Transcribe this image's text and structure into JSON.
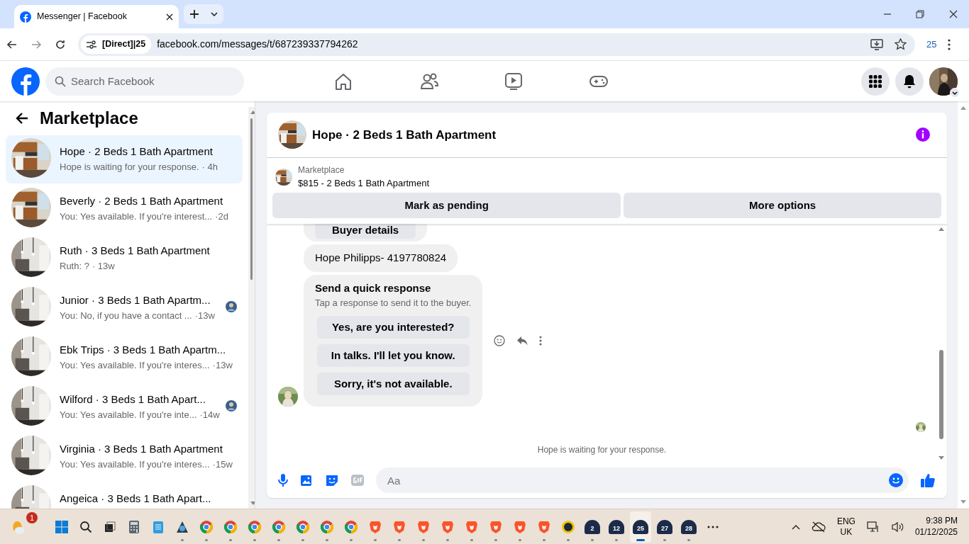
{
  "browser": {
    "tab_title": "Messenger | Facebook",
    "url_chip": "[Direct]|25",
    "url": "facebook.com/messages/t/687239337794262",
    "profile_count": "25"
  },
  "facebook": {
    "search": {
      "placeholder": "Search Facebook"
    }
  },
  "sidebar": {
    "title": "Marketplace",
    "conversations": [
      {
        "title": "Hope · 2 Beds 1 Bath Apartment",
        "preview": "Hope is waiting for your response.",
        "time": "· 4h",
        "selected": true,
        "seen": false
      },
      {
        "title": "Beverly · 2 Beds 1 Bath Apartment",
        "preview": "You: Yes available. If you're interest...",
        "time": "·2d",
        "selected": false,
        "seen": false
      },
      {
        "title": "Ruth · 3 Beds 1 Bath Apartment",
        "preview": "Ruth: ?",
        "time": "· 13w",
        "selected": false,
        "seen": false
      },
      {
        "title": "Junior · 3 Beds 1 Bath Apartm...",
        "preview": "You: No, if you have a contact ...",
        "time": "·13w",
        "selected": false,
        "seen": true
      },
      {
        "title": "Ebk Trips · 3 Beds 1 Bath Apartm...",
        "preview": "You: Yes available. If you're interes...",
        "time": "·13w",
        "selected": false,
        "seen": false
      },
      {
        "title": "Wilford · 3 Beds 1 Bath Apart...",
        "preview": "You: Yes available. If you're inte...",
        "time": "·14w",
        "selected": false,
        "seen": true
      },
      {
        "title": "Virginia · 3 Beds 1 Bath Apartment",
        "preview": "You: Yes available. If you're interes...",
        "time": "·15w",
        "selected": false,
        "seen": false
      },
      {
        "title": "Angeica · 3 Beds 1 Bath Apart...",
        "selected": false,
        "seen": false
      }
    ]
  },
  "conversation": {
    "title": "Hope · 2 Beds 1 Bath Apartment",
    "listing": {
      "label": "Marketplace",
      "item": "$815 - 2 Beds 1 Bath Apartment"
    },
    "actions": [
      "Mark as pending",
      "More options"
    ],
    "messages": [
      {
        "kind": "buttons",
        "buttons": [
          "Buyer details"
        ]
      },
      {
        "kind": "text",
        "text": "Hope Philipps- 4197780824"
      },
      {
        "kind": "quick_responses",
        "title": "Send a quick response",
        "subtitle": "Tap a response to send it to the buyer.",
        "options": [
          "Yes, are you interested?",
          "In talks. I'll let you know.",
          "Sorry, it's not available."
        ]
      }
    ],
    "status": "Hope is waiting for your response.",
    "composer": {
      "placeholder": "Aa"
    }
  },
  "taskbar": {
    "weather_badge": "1",
    "apps": [
      {
        "kind": "windows",
        "running": false,
        "selected": false
      },
      {
        "kind": "search",
        "running": false,
        "selected": false
      },
      {
        "kind": "taskview",
        "running": false,
        "selected": false
      },
      {
        "kind": "calculator",
        "running": false,
        "selected": false
      },
      {
        "kind": "notepad",
        "running": false,
        "selected": false
      },
      {
        "kind": "app",
        "running": true,
        "selected": false
      },
      {
        "kind": "chrome",
        "running": true,
        "selected": false
      },
      {
        "kind": "chrome",
        "running": true,
        "selected": false
      },
      {
        "kind": "chrome",
        "running": true,
        "selected": false
      },
      {
        "kind": "chrome",
        "running": true,
        "selected": false
      },
      {
        "kind": "chrome",
        "running": true,
        "selected": false
      },
      {
        "kind": "chrome",
        "running": true,
        "selected": false
      },
      {
        "kind": "chrome",
        "running": true,
        "selected": false
      },
      {
        "kind": "brave",
        "running": true,
        "selected": false
      },
      {
        "kind": "brave",
        "running": true,
        "selected": false
      },
      {
        "kind": "brave",
        "running": true,
        "selected": false
      },
      {
        "kind": "brave",
        "running": true,
        "selected": false
      },
      {
        "kind": "brave",
        "running": true,
        "selected": false
      },
      {
        "kind": "brave",
        "running": true,
        "selected": false
      },
      {
        "kind": "brave",
        "running": true,
        "selected": false
      },
      {
        "kind": "brave",
        "running": true,
        "selected": false
      },
      {
        "kind": "ix",
        "running": true,
        "selected": false
      },
      {
        "kind": "counter",
        "label": "2",
        "running": true,
        "selected": false
      },
      {
        "kind": "counter",
        "label": "12",
        "running": true,
        "selected": false
      },
      {
        "kind": "counter",
        "label": "25",
        "running": true,
        "selected": true
      },
      {
        "kind": "counter",
        "label": "27",
        "running": true,
        "selected": false
      },
      {
        "kind": "counter",
        "label": "28",
        "running": true,
        "selected": false
      },
      {
        "kind": "more",
        "running": false,
        "selected": false
      }
    ],
    "language": "ENG",
    "region": "UK",
    "time": "9:38 PM",
    "date": "01/12/2025"
  }
}
